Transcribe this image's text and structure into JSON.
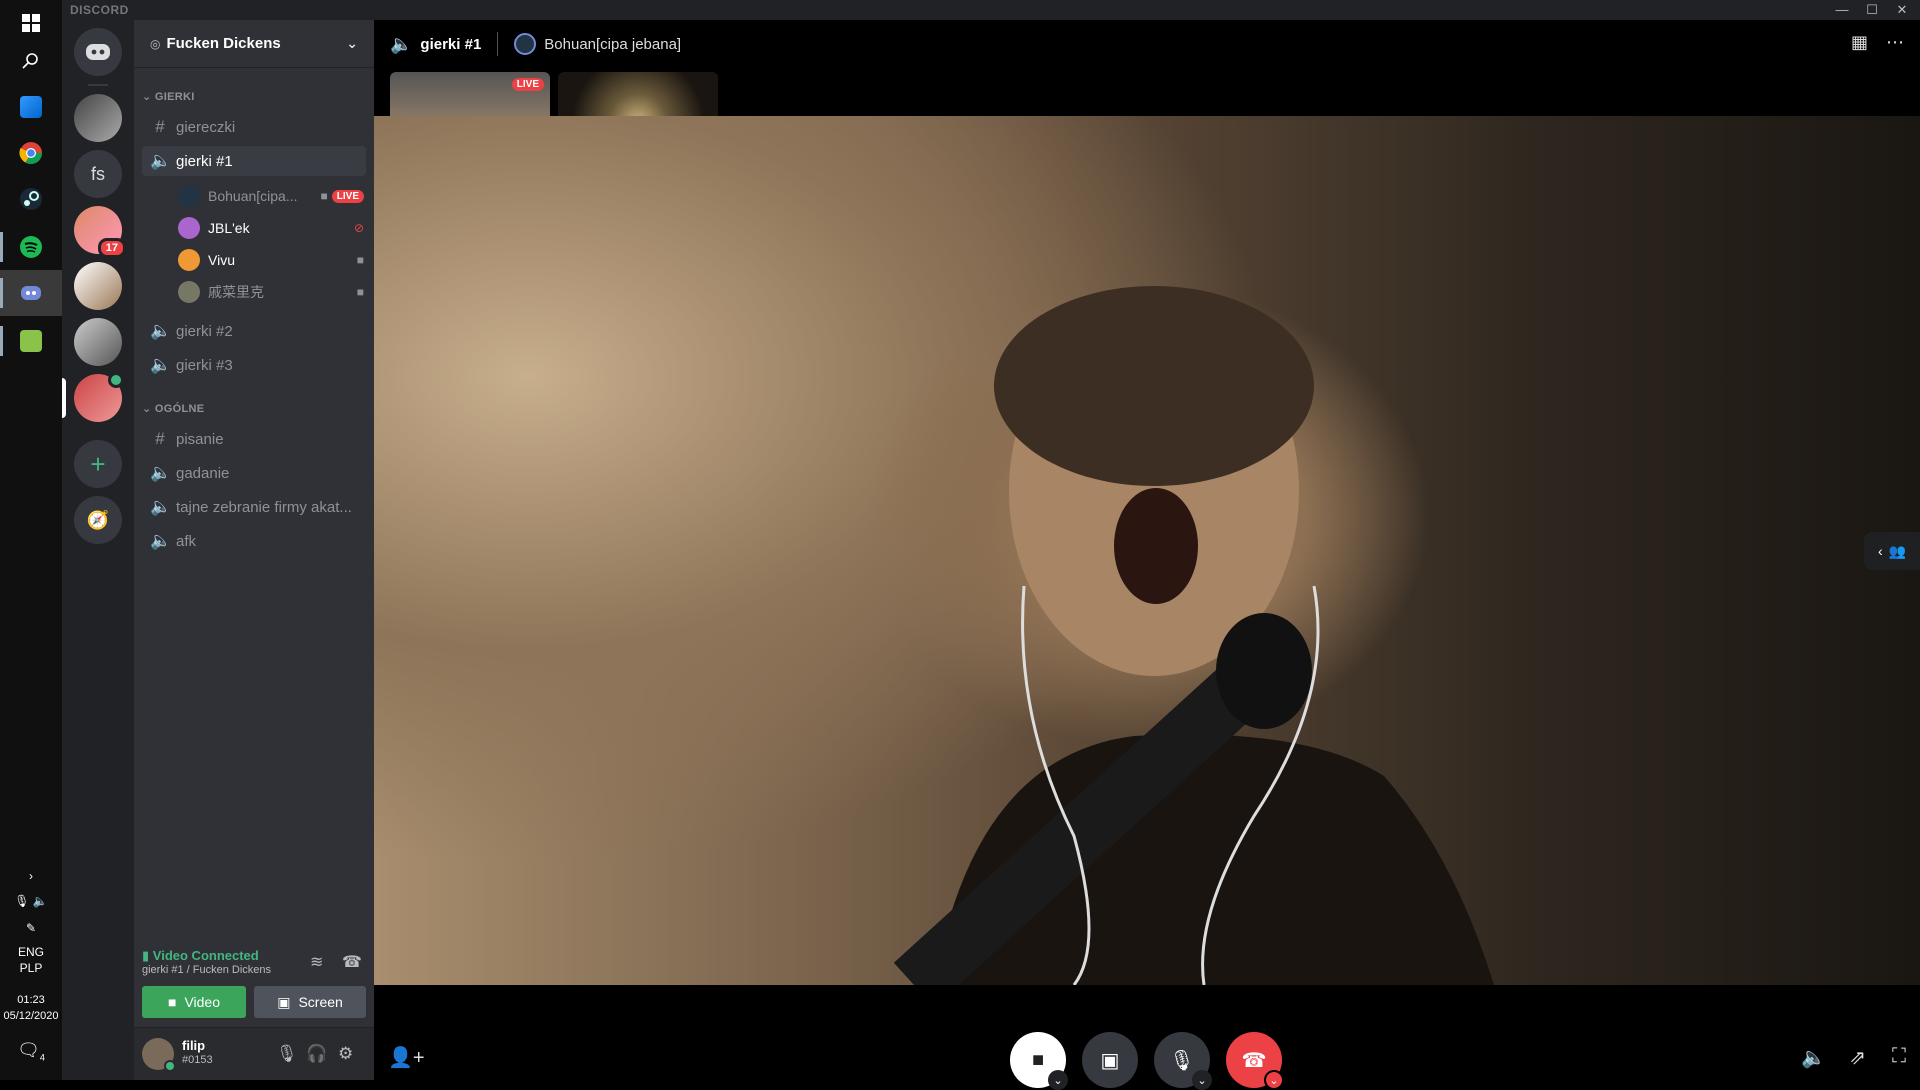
{
  "taskbar": {
    "lang_top": "ENG",
    "lang_bottom": "PLP",
    "time": "01:23",
    "date": "05/12/2020",
    "notifications": "4"
  },
  "app": {
    "brand": "DISCORD"
  },
  "servers": {
    "fs_label": "fs",
    "badge": "17"
  },
  "guild": {
    "name": "Fucken Dickens",
    "categories": [
      "GIERKI",
      "OGÓLNE"
    ],
    "channels": {
      "gierki": [
        {
          "name": "giereczki",
          "type": "text"
        },
        {
          "name": "gierki #1",
          "type": "voice"
        },
        {
          "name": "gierki #2",
          "type": "voice"
        },
        {
          "name": "gierki #3",
          "type": "voice"
        }
      ],
      "ogolne": [
        {
          "name": "pisanie",
          "type": "text"
        },
        {
          "name": "gadanie",
          "type": "voice"
        },
        {
          "name": "tajne zebranie firmy akat...",
          "type": "voice"
        },
        {
          "name": "afk",
          "type": "voice"
        }
      ]
    },
    "voice_users": [
      {
        "name": "Bohuan[cipa...",
        "live": "LIVE"
      },
      {
        "name": "JBL'ek"
      },
      {
        "name": "Vivu"
      },
      {
        "name": "戚菜里克"
      }
    ]
  },
  "rtc": {
    "status": "Video Connected",
    "location": "gierki #1 / Fucken Dickens",
    "video_label": "Video",
    "screen_label": "Screen"
  },
  "user": {
    "name": "filip",
    "tag": "#0153"
  },
  "call": {
    "channel": "gierki #1",
    "streamer": "Bohuan[cipa jebana]",
    "thumb_live": "LIVE"
  },
  "colors": {
    "accent_green": "#43b581",
    "danger_red": "#ed4245",
    "blurple": "#7289da"
  }
}
